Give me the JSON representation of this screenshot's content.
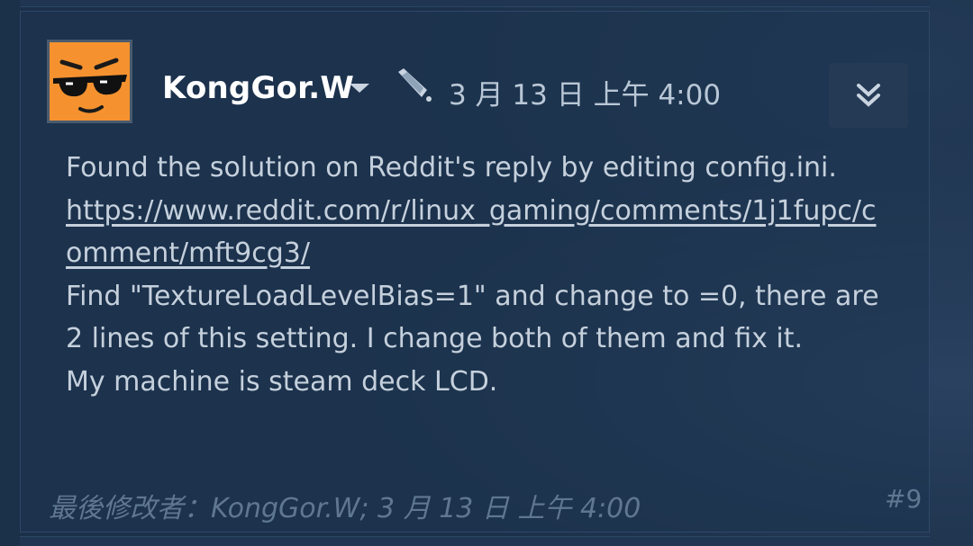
{
  "post": {
    "author": "KongGor.W",
    "timestamp": "3 月 13 日 上午 4:00",
    "body": {
      "line1": "Found the solution on Reddit's reply by editing config.ini.",
      "link": "https://www.reddit.com/r/linux_gaming/comments/1j1fupc/comment/mft9cg3/",
      "paragraph2": "Find \"TextureLoadLevelBias=1\" and change to =0, there are 2 lines of this setting. I change both of them and fix it.",
      "paragraph3": "My machine is steam deck LCD."
    },
    "edited_note": "最後修改者：KongGor.W; 3 月 13 日 上午 4:00",
    "post_number": "#9"
  },
  "icons": {
    "avatar": "sunglasses-face-avatar",
    "author_menu": "caret-down-icon",
    "device": "steam-deck-device-icon",
    "expand": "chevron-double-down-icon"
  }
}
